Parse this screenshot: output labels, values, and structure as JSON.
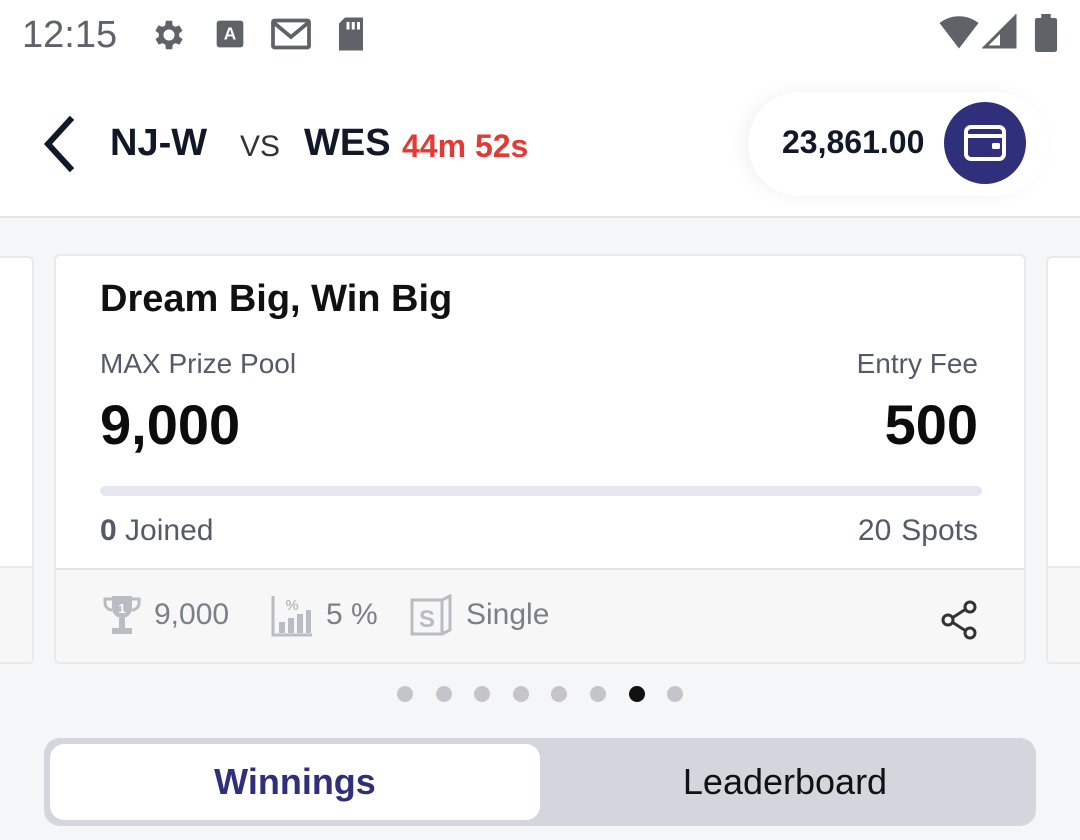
{
  "status_bar": {
    "time": "12:15",
    "icons": [
      "gear-icon",
      "keyboard-a-icon",
      "gmail-icon",
      "sd-card-icon",
      "wifi-icon",
      "signal-icon",
      "battery-icon"
    ]
  },
  "header": {
    "team1": "NJ-W",
    "vs": "VS",
    "team2": "WES",
    "timer": "44m 52s",
    "balance": "23,861.00",
    "timer_color": "#e53935",
    "wallet_color": "#2f2f7b"
  },
  "contest_card": {
    "title": "Dream Big, Win Big",
    "prize_label": "MAX Prize Pool",
    "prize_value": "9,000",
    "fee_label": "Entry Fee",
    "fee_value": "500",
    "joined_count": "0",
    "joined_label": "Joined",
    "spots_count": "20",
    "spots_label": "Spots",
    "fill_fraction": 0,
    "footer": {
      "first_prize": "9,000",
      "winners_percent": "5 %",
      "entry_type": "Single"
    }
  },
  "pager": {
    "total": 8,
    "active_index": 6
  },
  "tabs": {
    "winnings": "Winnings",
    "leaderboard": "Leaderboard",
    "active": "winnings"
  }
}
